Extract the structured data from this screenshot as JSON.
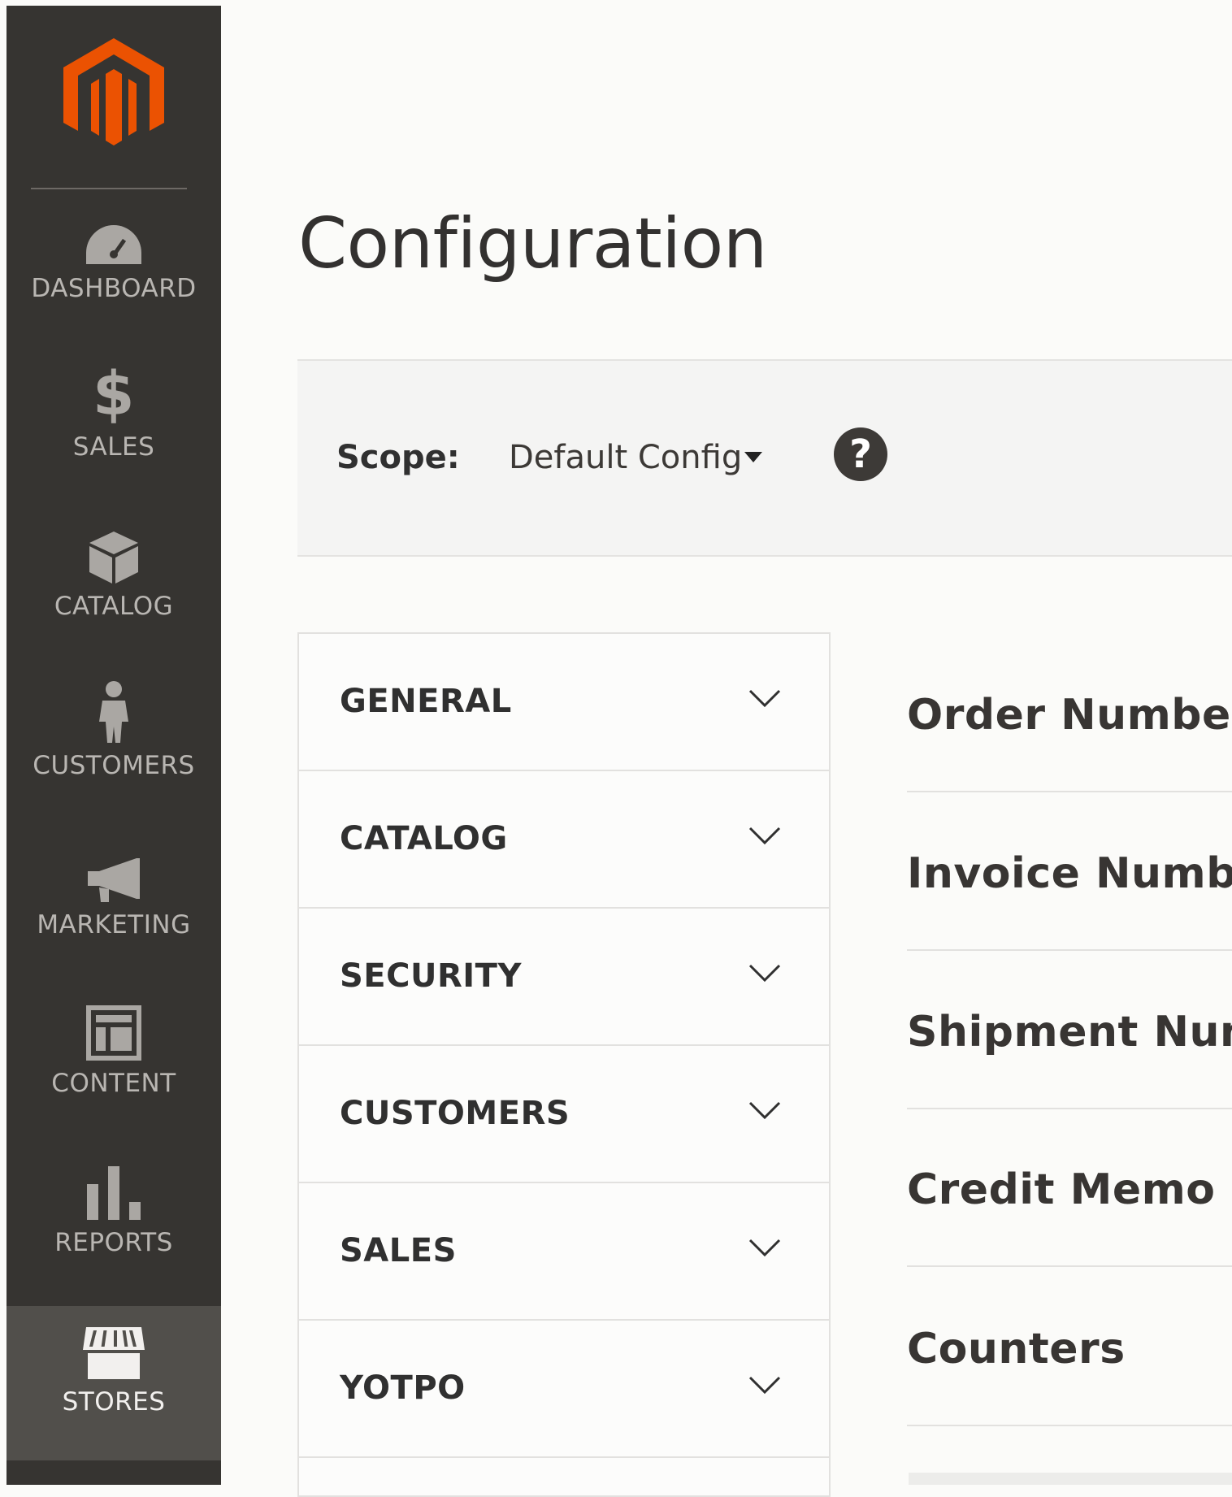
{
  "sidebar": {
    "items": [
      {
        "label": "DASHBOARD",
        "icon": "dashboard-icon"
      },
      {
        "label": "SALES",
        "icon": "dollar-icon"
      },
      {
        "label": "CATALOG",
        "icon": "box-icon"
      },
      {
        "label": "CUSTOMERS",
        "icon": "person-icon"
      },
      {
        "label": "MARKETING",
        "icon": "megaphone-icon"
      },
      {
        "label": "CONTENT",
        "icon": "layout-icon"
      },
      {
        "label": "REPORTS",
        "icon": "bar-chart-icon"
      },
      {
        "label": "STORES",
        "icon": "storefront-icon",
        "active": true
      }
    ]
  },
  "page": {
    "title": "Configuration"
  },
  "scope": {
    "label": "Scope:",
    "value": "Default Config",
    "help": "?"
  },
  "tabs": [
    {
      "label": "GENERAL"
    },
    {
      "label": "CATALOG"
    },
    {
      "label": "SECURITY"
    },
    {
      "label": "CUSTOMERS"
    },
    {
      "label": "SALES"
    },
    {
      "label": "YOTPO"
    }
  ],
  "sections": [
    {
      "label": "Order Number"
    },
    {
      "label": "Invoice Numbe"
    },
    {
      "label": "Shipment Num"
    },
    {
      "label": "Credit Memo N"
    },
    {
      "label": "Counters"
    }
  ],
  "colors": {
    "accent": "#eb5202",
    "sidebar": "#363431",
    "active": "#514f4b"
  }
}
